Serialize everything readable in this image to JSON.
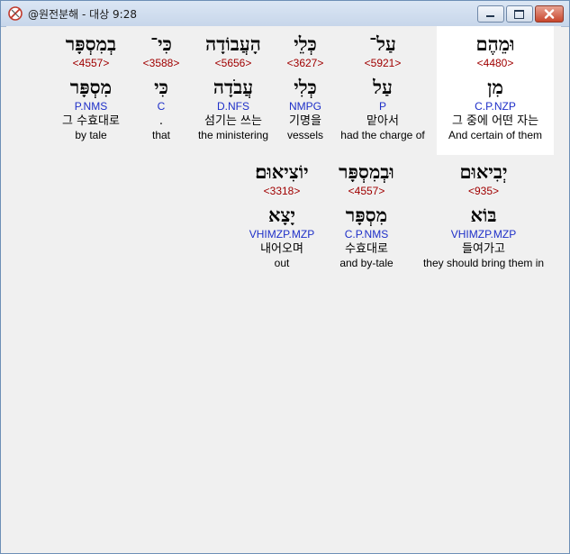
{
  "window": {
    "title": "@원전분해 - 대상 9:28",
    "controls": {
      "minimize_icon": "minimize-icon",
      "maximize_icon": "maximize-icon",
      "close_icon": "close-icon"
    }
  },
  "rows": [
    {
      "words": [
        {
          "hebrew": "וּמֵהֶם",
          "strong": "<4480>",
          "lemma": "מִן",
          "parse": "C.P.NZP",
          "korean": "그 중에 어떤 자는",
          "english": "And certain of them",
          "highlighted": true
        },
        {
          "hebrew": "עַל־",
          "strong": "<5921>",
          "lemma": "עַל",
          "parse": "P",
          "korean": "맡아서",
          "english": "had the charge of"
        },
        {
          "hebrew": "כְּלֵי",
          "strong": "<3627>",
          "lemma": "כְּלִי",
          "parse": "NMPG",
          "korean": "기명을",
          "english": "vessels"
        },
        {
          "hebrew": "הָעֲבוֹדָה",
          "strong": "<5656>",
          "lemma": "עֲבֹדָה",
          "parse": "D.NFS",
          "korean": "섬기는 쓰는",
          "english": "the ministering"
        },
        {
          "hebrew": "כִּי־",
          "strong": "<3588>",
          "lemma": "כִּי",
          "parse": "C",
          "korean": ".",
          "english": "that"
        },
        {
          "hebrew": "בְמִסְפָּר",
          "strong": "<4557>",
          "lemma": "מִסְפָּר",
          "parse": "P.NMS",
          "korean": "그 수효대로",
          "english": "by tale"
        }
      ]
    },
    {
      "words": [
        {
          "hebrew": "יְבִיאוּם",
          "strong": "<935>",
          "lemma": "בּוֹא",
          "parse": "VHIMZP.MZP",
          "korean": "들여가고",
          "english": "they should bring them in"
        },
        {
          "hebrew": "וּבְמִסְפָּר",
          "strong": "<4557>",
          "lemma": "מִסְפָּר",
          "parse": "C.P.NMS",
          "korean": "수효대로",
          "english": "and by-tale"
        },
        {
          "hebrew": "יוֹצִיאוּם׃",
          "strong": "<3318>",
          "lemma": "יָצָא",
          "parse": "VHIMZP.MZP",
          "korean": "내어오며",
          "english": "out"
        }
      ]
    }
  ]
}
